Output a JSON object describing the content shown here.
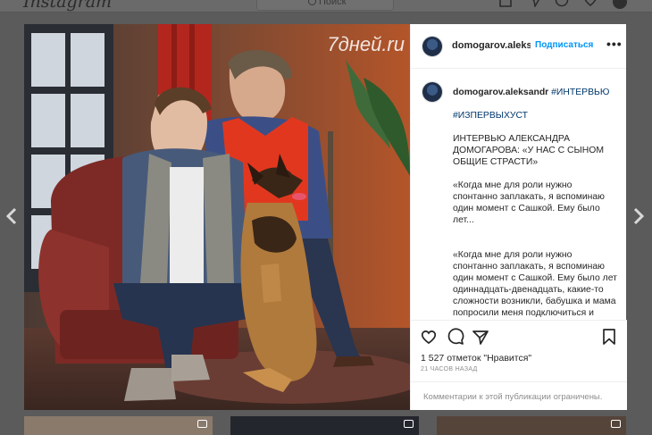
{
  "topbar": {
    "logo": "Instagram",
    "search_placeholder": "Поиск"
  },
  "post": {
    "watermark": "7дней.ru",
    "username": "domogarov.aleksandr",
    "follow_label": "Подписаться",
    "more_label": "•••",
    "caption": {
      "hashtag1": "#ИНТЕРВЬЮ",
      "hashtag2": "#ИЗПЕРВЫХУСТ",
      "title": "ИНТЕРВЬЮ АЛЕКСАНДРА ДОМОГАРОВА: «У НАС С СЫНОМ ОБЩИЕ СТРАСТИ»",
      "quote1": "«Когда мне для роли нужно спонтанно заплакать, я вспоминаю один момент с Сашкой. Ему было лет...",
      "quote2": "«Когда мне для роли нужно спонтанно заплакать, я вспоминаю один момент с Сашкой. Ему было лет одиннадцать-двенадцать, какие-то сложности возникли, бабушка и мама попросили меня подключиться и повлиять. Я"
    },
    "likes": "1 527 отметок \"Нравится\"",
    "time": "21 ЧАСОВ НАЗАД",
    "comments_disabled": "Комментарии к этой публикации ограничены."
  },
  "icons": {
    "nav": [
      "home-icon",
      "direct-icon",
      "explore-icon",
      "heart-icon",
      "profile-avatar"
    ],
    "actions": [
      "like-icon",
      "comment-icon",
      "share-icon",
      "save-icon"
    ],
    "arrows": [
      "chevron-left-icon",
      "chevron-right-icon"
    ],
    "thumb_badge": "video-camera-icon"
  }
}
